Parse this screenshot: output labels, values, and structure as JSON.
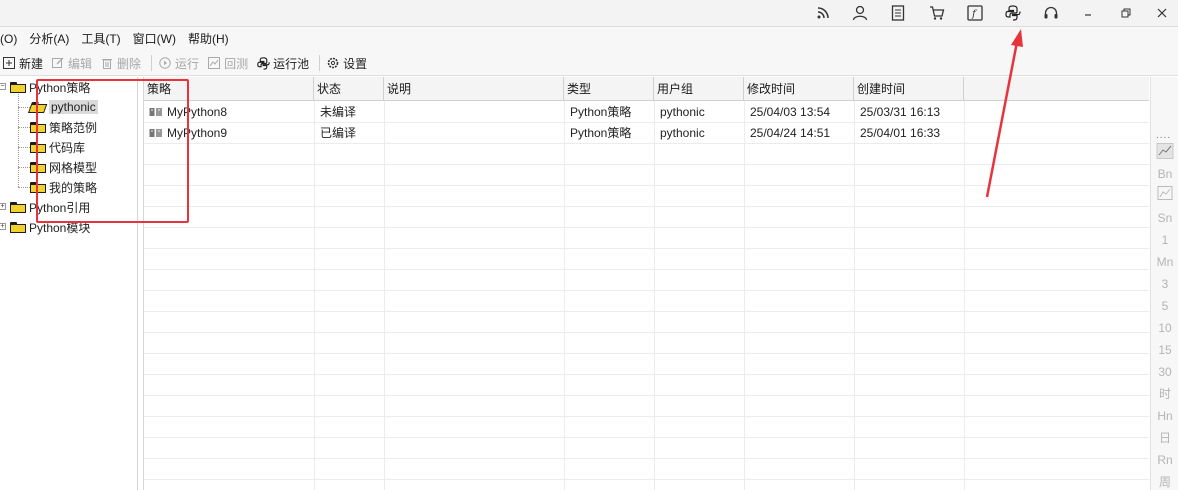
{
  "menu": {
    "items": [
      "(O)",
      "分析(A)",
      "工具(T)",
      "窗口(W)",
      "帮助(H)"
    ]
  },
  "toolbar": {
    "new_label": "新建",
    "edit_label": "编辑",
    "delete_label": "删除",
    "run_label": "运行",
    "backtest_label": "回测",
    "pool_label": "运行池",
    "settings_label": "设置"
  },
  "tree": {
    "root1": "Python策略",
    "root1_children": [
      "pythonic",
      "策略范例",
      "代码库",
      "网格模型",
      "我的策略"
    ],
    "root2": "Python引用",
    "root3": "Python模块"
  },
  "table": {
    "columns": [
      "策略",
      "状态",
      "说明",
      "类型",
      "用户组",
      "修改时间",
      "创建时间"
    ],
    "rows": [
      {
        "name": "MyPython8",
        "status": "未编译",
        "desc": "",
        "type": "Python策略",
        "group": "pythonic",
        "modified": "25/04/03 13:54",
        "created": "25/03/31 16:13"
      },
      {
        "name": "MyPython9",
        "status": "已编译",
        "desc": "",
        "type": "Python策略",
        "group": "pythonic",
        "modified": "25/04/24 14:51",
        "created": "25/04/01 16:33"
      }
    ]
  },
  "sidebar_right": {
    "items": [
      "Bn",
      "Sn",
      "1",
      "Mn",
      "3",
      "5",
      "10",
      "15",
      "30",
      "时",
      "Hn",
      "日",
      "Rn",
      "周"
    ]
  },
  "colors": {
    "annotation": "#e8333d",
    "folder": "#f2d12c"
  }
}
